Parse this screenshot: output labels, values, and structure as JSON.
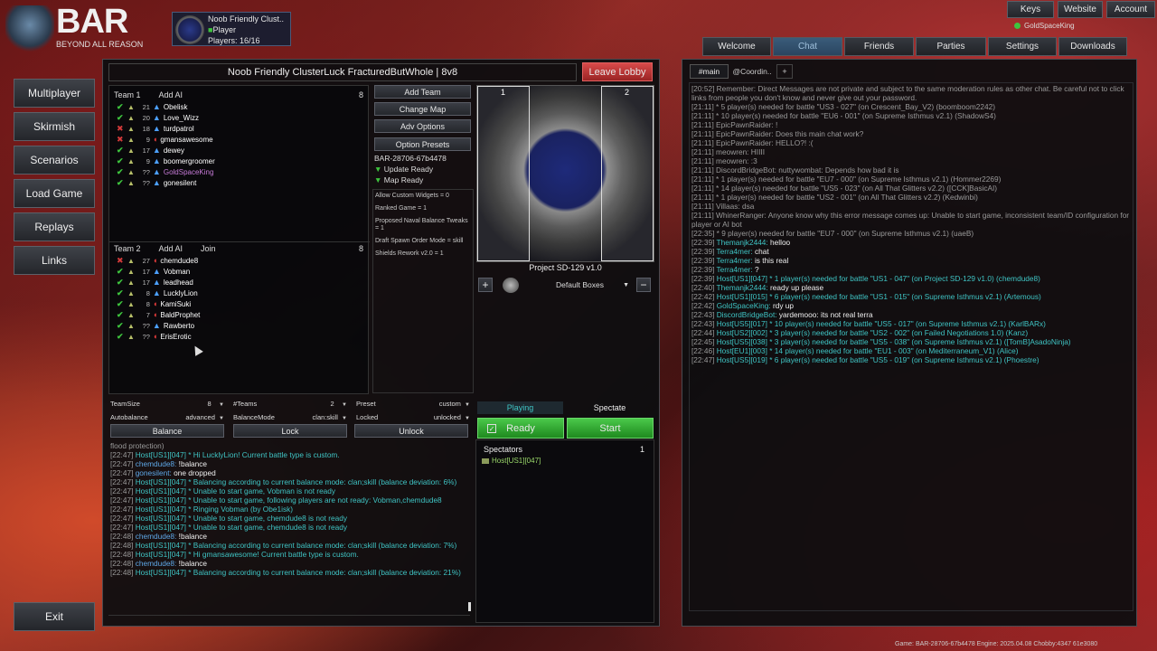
{
  "top": {
    "keys": "Keys",
    "website": "Website",
    "account": "Account",
    "user": "GoldSpaceKing"
  },
  "logo": {
    "big": "BAR",
    "small": "BEYOND ALL REASON"
  },
  "lobby_card": {
    "title": "Noob Friendly Clust..",
    "role": "Player",
    "players": "Players: 16/16"
  },
  "nav": [
    "Multiplayer",
    "Skirmish",
    "Scenarios",
    "Load Game",
    "Replays",
    "Links"
  ],
  "exit": "Exit",
  "battle": {
    "title": "Noob Friendly ClusterLuck FracturedButWhole | 8v8",
    "leave": "Leave Lobby"
  },
  "team1": {
    "label": "Team 1",
    "add": "Add AI",
    "count": "8",
    "players": [
      {
        "status": "ok",
        "rank": "21",
        "tri": true,
        "name": "Obelisk",
        "color": "#ffffff"
      },
      {
        "status": "ok",
        "rank": "20",
        "tri": true,
        "name": "Love_Wizz",
        "color": "#ffffff"
      },
      {
        "status": "x",
        "rank": "18",
        "tri": true,
        "name": "turdpatrol",
        "color": "#ffffff"
      },
      {
        "status": "x",
        "rank": "9",
        "tri": false,
        "name": "gmansawesome",
        "color": "#ffffff"
      },
      {
        "status": "ok",
        "rank": "17",
        "tri": true,
        "name": "dewey",
        "color": "#ffffff"
      },
      {
        "status": "ok",
        "rank": "9",
        "tri": true,
        "name": "boomergroomer",
        "color": "#ffffff"
      },
      {
        "status": "ok",
        "rank": "??",
        "tri": true,
        "name": "GoldSpaceKing",
        "color": "#c77bd8"
      },
      {
        "status": "ok",
        "rank": "??",
        "tri": true,
        "name": "gonesilent",
        "color": "#ffffff"
      }
    ]
  },
  "team2": {
    "label": "Team 2",
    "add": "Add AI",
    "join": "Join",
    "count": "8",
    "players": [
      {
        "status": "x",
        "rank": "27",
        "tri": false,
        "name": "chemdude8",
        "color": "#ffffff"
      },
      {
        "status": "ok",
        "rank": "17",
        "tri": true,
        "name": "Vobman",
        "color": "#ffffff"
      },
      {
        "status": "ok",
        "rank": "17",
        "tri": true,
        "name": "leadhead",
        "color": "#ffffff"
      },
      {
        "status": "ok",
        "rank": "8",
        "tri": true,
        "name": "LucklyLion",
        "color": "#ffffff"
      },
      {
        "status": "ok",
        "rank": "8",
        "tri": false,
        "name": "KamiSuki",
        "color": "#ffffff"
      },
      {
        "status": "ok",
        "rank": "7",
        "tri": false,
        "name": "BaldProphet",
        "color": "#ffffff"
      },
      {
        "status": "ok",
        "rank": "??",
        "tri": true,
        "name": "Rawberto",
        "color": "#ffffff"
      },
      {
        "status": "ok",
        "rank": "??",
        "tri": false,
        "name": "ErisErotic",
        "color": "#ffffff"
      }
    ]
  },
  "controls": {
    "add_team": "Add Team",
    "change_map": "Change Map",
    "adv_options": "Adv Options",
    "option_presets": "Option Presets",
    "game_id": "BAR-28706-67b4478",
    "update_ready": "Update Ready",
    "map_ready": "Map Ready",
    "options": [
      "Allow Custom Widgets = 0",
      "Ranked Game = 1",
      "Proposed Naval Balance Tweaks = 1",
      "Draft Spawn Order Mode = skill",
      "Shields Rework v2.0 = 1"
    ]
  },
  "map": {
    "name": "Project SD-129 v1.0",
    "start1": "1",
    "start2": "2",
    "boxes": "Default Boxes",
    "plus": "+",
    "minus": "−"
  },
  "settings": {
    "teamsize_l": "TeamSize",
    "teamsize_v": "8",
    "teams_l": "#Teams",
    "teams_v": "2",
    "preset_l": "Preset",
    "preset_v": "custom",
    "autobalance_l": "Autobalance",
    "autobalance_v": "advanced",
    "balancemode_l": "BalanceMode",
    "balancemode_v": "clan:skill",
    "locked_l": "Locked",
    "locked_v": "unlocked",
    "balance": "Balance",
    "lock": "Lock",
    "unlock": "Unlock"
  },
  "play": {
    "playing": "Playing",
    "spectate": "Spectate",
    "ready": "Ready",
    "start": "Start"
  },
  "spectators": {
    "label": "Spectators",
    "count": "1",
    "list": [
      "Host[US1][047]"
    ]
  },
  "lobby_chat": [
    [
      "gr",
      "flood protection)",
      ""
    ],
    [
      "gr",
      "[22:47] ",
      "cy",
      "Host[US1][047] * Hi LucklyLion! Current battle type is custom."
    ],
    [
      "gr",
      "[22:47] ",
      "bl",
      "chemdude8: ",
      "wh",
      "!balance"
    ],
    [
      "gr",
      "[22:47] ",
      "bl",
      "gonesilent: ",
      "wh",
      "one dropped"
    ],
    [
      "gr",
      "[22:47] ",
      "cy",
      "Host[US1][047] * Balancing according to current balance mode: clan;skill (balance deviation: 6%)"
    ],
    [
      "gr",
      "[22:47] ",
      "cy",
      "Host[US1][047] * Unable to start game, Vobman is not ready"
    ],
    [
      "gr",
      "[22:47] ",
      "cy",
      "Host[US1][047] * Unable to start game, following players are not ready: Vobman,chemdude8"
    ],
    [
      "gr",
      "[22:47] ",
      "cy",
      "Host[US1][047] * Ringing Vobman (by Obe1isk)"
    ],
    [
      "gr",
      "[22:47] ",
      "cy",
      "Host[US1][047] * Unable to start game, chemdude8 is not ready"
    ],
    [
      "gr",
      "[22:47] ",
      "cy",
      "Host[US1][047] * Unable to start game, chemdude8 is not ready"
    ],
    [
      "gr",
      "[22:48] ",
      "bl",
      "chemdude8: ",
      "wh",
      "!balance"
    ],
    [
      "gr",
      "[22:48] ",
      "cy",
      "Host[US1][047] * Balancing according to current balance mode: clan;skill (balance deviation: 7%)"
    ],
    [
      "gr",
      "[22:48] ",
      "cy",
      "Host[US1][047] * Hi gmansawesome! Current battle type is custom."
    ],
    [
      "gr",
      "[22:48] ",
      "bl",
      "chemdude8: ",
      "wh",
      "!balance"
    ],
    [
      "gr",
      "[22:48] ",
      "cy",
      "Host[US1][047] * Balancing according to current balance mode: clan;skill (balance deviation: 21%)"
    ]
  ],
  "right_tabs": [
    "Welcome",
    "Chat",
    "Friends",
    "Parties",
    "Settings",
    "Downloads"
  ],
  "chat_tabs": [
    "#main",
    "@Coordin..",
    "+"
  ],
  "main_chat": [
    [
      "gr",
      "[20:52] Remember: Direct Messages are not private and subject to the same moderation rules as other chat. Be careful not to click links from people you don't know and never give out your password."
    ],
    [
      "gr",
      "[21:11] * 5 player(s) needed for battle \"US3 - 027\" (on Crescent_Bay_V2) (boomboom2242)"
    ],
    [
      "gr",
      "[21:11] * 10 player(s) needed for battle \"EU6 - 001\" (on Supreme Isthmus v2.1) (ShadowS4)"
    ],
    [
      "gr",
      "[21:11] EpicPawnRaider: !"
    ],
    [
      "gr",
      "[21:11] EpicPawnRaider: Does this main chat work?"
    ],
    [
      "gr",
      "[21:11] EpicPawnRaider: HELLO?! :("
    ],
    [
      "gr",
      "[21:11] meowren: HIIII"
    ],
    [
      "gr",
      "[21:11] meowren: :3"
    ],
    [
      "gr",
      "[21:11] DiscordBridgeBot: nuttywombat: Depends how bad it is"
    ],
    [
      "gr",
      "[21:11] * 1 player(s) needed for battle \"EU7 - 000\" (on Supreme Isthmus v2.1) (Hommer2269)"
    ],
    [
      "gr",
      "[21:11] * 14 player(s) needed for battle \"US5 - 023\" (on All That Glitters v2.2) ([CCK]BasicAI)"
    ],
    [
      "gr",
      "[21:11] * 1 player(s) needed for battle \"US2 - 001\" (on All That Glitters v2.2) (Kedwinbi)"
    ],
    [
      "gr",
      "[21:11] Villaas: dsa"
    ],
    [
      "gr",
      "[21:11] WhinerRanger: Anyone know why this error message comes up: Unable to start game, inconsistent team/ID configuration for player or AI bot"
    ],
    [
      "gr",
      "[22:35] * 9 player(s) needed for battle \"EU7 - 000\" (on Supreme Isthmus v2.1) (uaeB)"
    ],
    [
      "gr",
      "[22:39] ",
      "cy",
      "Themanjk2444: ",
      "wh",
      "helloo"
    ],
    [
      "gr",
      "[22:39] ",
      "cy",
      "Terra4mer: ",
      "wh",
      "chat"
    ],
    [
      "gr",
      "[22:39] ",
      "cy",
      "Terra4mer: ",
      "wh",
      "is this real"
    ],
    [
      "gr",
      "[22:39] ",
      "cy",
      "Terra4mer: ",
      "wh",
      "?"
    ],
    [
      "gr",
      "[22:39] ",
      "cy",
      "Host[US1][047] * 1 player(s) needed for battle \"US1 - 047\" (on Project SD-129 v1.0) (chemdude8)"
    ],
    [
      "gr",
      "[22:40] ",
      "cy",
      "Themanjk2444: ",
      "wh",
      "ready up please"
    ],
    [
      "gr",
      "[22:42] ",
      "cy",
      "Host[US1][015] * 6 player(s) needed for battle \"US1 - 015\" (on Supreme Isthmus v2.1) (Artemous)"
    ],
    [
      "gr",
      "[22:42] ",
      "cy",
      "GoldSpaceKing: ",
      "wh",
      "rdy up"
    ],
    [
      "gr",
      "[22:43] ",
      "cy",
      "DiscordBridgeBot: ",
      "wh",
      "yardemooo: its not real terra"
    ],
    [
      "gr",
      "[22:43] ",
      "cy",
      "Host[US5][017] * 10 player(s) needed for battle \"US5 - 017\" (on Supreme Isthmus v2.1) (KarlBARx)"
    ],
    [
      "gr",
      "[22:44] ",
      "cy",
      "Host[US2][002] * 3 player(s) needed for battle \"US2 - 002\" (on Failed Negotiations 1.0) (Kanz)"
    ],
    [
      "gr",
      "[22:45] ",
      "cy",
      "Host[US5][038] * 3 player(s) needed for battle \"US5 - 038\" (on Supreme Isthmus v2.1) ([TomB]AsadoNinja)"
    ],
    [
      "gr",
      "[22:46] ",
      "cy",
      "Host[EU1][003] * 14 player(s) needed for battle \"EU1 - 003\" (on Mediterraneum_V1) (Alice)"
    ],
    [
      "gr",
      "[22:47] ",
      "cy",
      "Host[US5][019] * 6 player(s) needed for battle \"US5 - 019\" (on Supreme Isthmus v2.1) (Phoestre)"
    ]
  ],
  "footer": "Game: BAR-28706-67b4478  Engine: 2025.04.08  Chobby:4347 61e3080",
  "colors": {
    "accent_green": "#2fae2f",
    "leave_red": "#c43a3a",
    "cyan": "#3fc4c4",
    "purple": "#c77bd8"
  }
}
